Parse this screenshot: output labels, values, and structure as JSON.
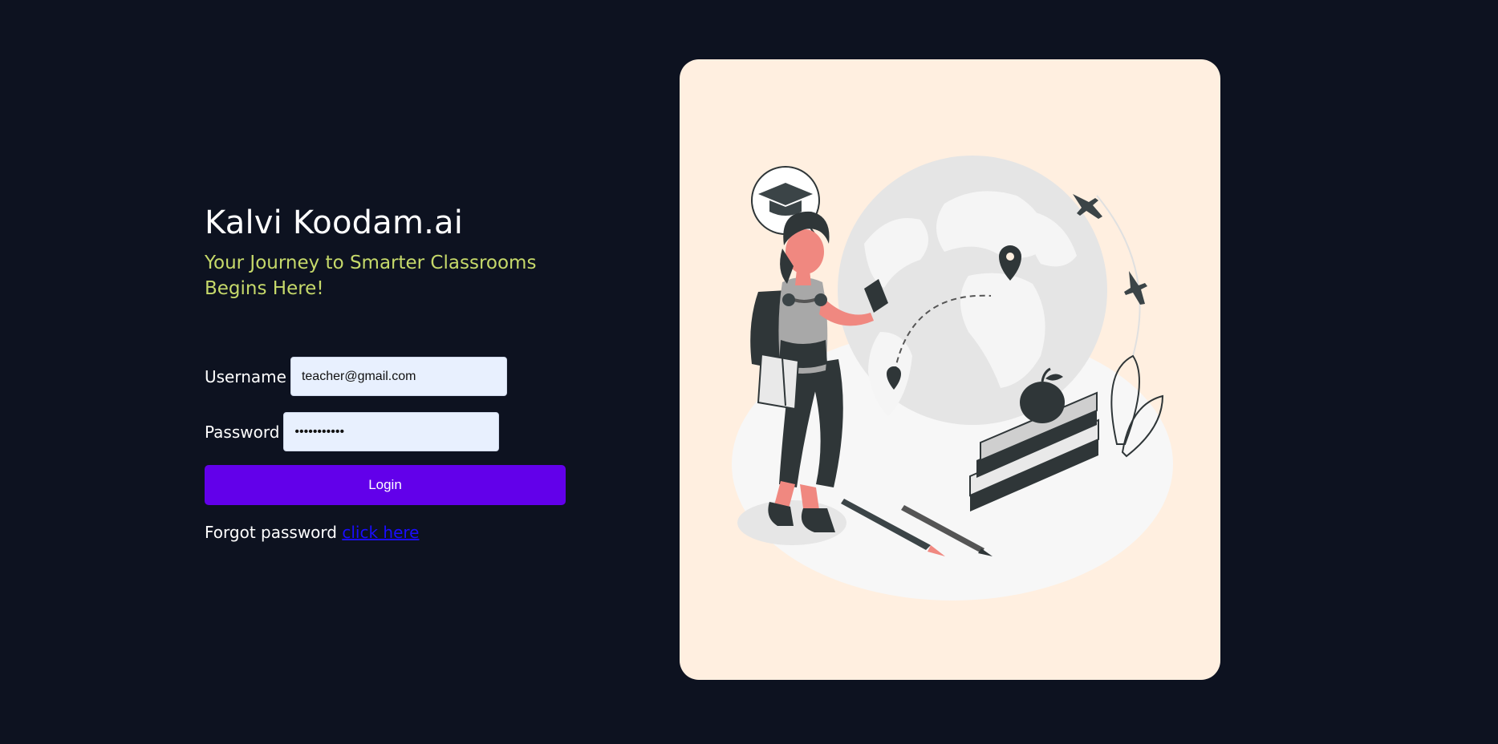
{
  "brand": {
    "title": "Kalvi Koodam.ai",
    "tagline": "Your Journey to Smarter Classrooms Begins Here!"
  },
  "login_form": {
    "username_label": "Username",
    "username_value": "teacher@gmail.com",
    "password_label": "Password",
    "password_value": "•••••••••••",
    "login_button": "Login",
    "forgot_text": "Forgot password",
    "forgot_link": "click here"
  },
  "illustration": {
    "icon": "student-globe-illustration",
    "colors": {
      "card_background": "#ffefe0",
      "accent_skin": "#f08880",
      "dark": "#2f3638"
    }
  },
  "theme": {
    "page_background": "#0d1220",
    "tagline_color": "#c6d96a",
    "button_color": "#6200ea",
    "link_color": "#1a0dff"
  }
}
